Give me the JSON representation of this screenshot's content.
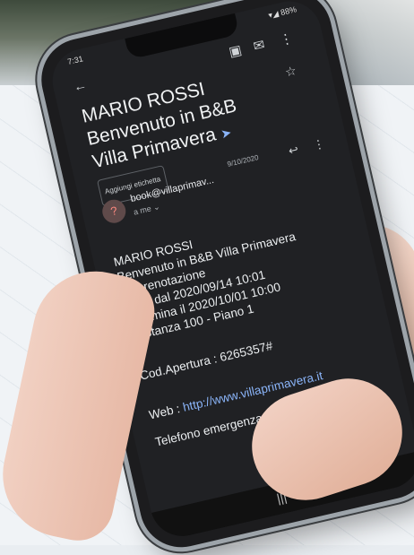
{
  "status": {
    "time": "7:31",
    "right": "▾◢ 88%"
  },
  "toolbar": {
    "back_icon": "arrow-back-icon",
    "archive_icon": "archive-icon",
    "mail_icon": "mail-icon",
    "more_icon": "more-vert-icon"
  },
  "email": {
    "subject_line1": "MARIO ROSSI",
    "subject_line2": "Benvenuto in B&B",
    "subject_line3": "Villa Primavera",
    "chip": "Aggiungi etichetta",
    "sender": "book@villaprimav...",
    "date": "9/10/2020",
    "to": "a me ⌄",
    "avatar": "?",
    "body": {
      "l1": "MARIO ROSSI",
      "l2": "Benvenuto in B&B Villa Primavera",
      "l3": "La prenotazione",
      "l4": "inizia dal 2020/09/14 10:01",
      "l5": "e termina il 2020/10/01 10:00",
      "l6": "in Stanza 100 - Piano 1",
      "code": "Cod.Apertura : 6265357#",
      "web_label": "Web : ",
      "web_link": "http://www.villaprimavera.it",
      "phone": "Telefono emergenza : 0112330111"
    }
  },
  "nav": {
    "home": "|||"
  }
}
